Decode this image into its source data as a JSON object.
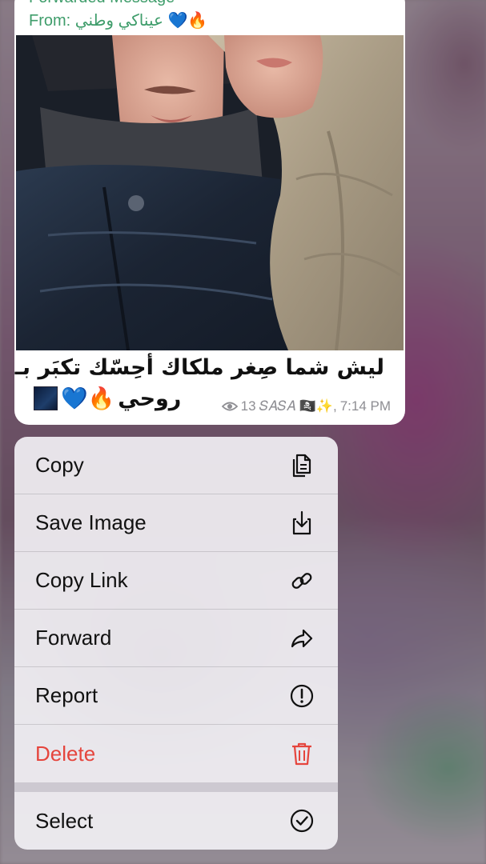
{
  "message": {
    "forward_title": "Forwarded Message",
    "forward_from_label": "From:",
    "forward_from_name": "عيناكي وطني",
    "forward_from_emoji": "💙🔥",
    "caption_line1": "ليش شما صِغر ملكاك أحِسّك تكبَر بـ",
    "caption_line2": "روحي",
    "caption_emoji": "💙🔥",
    "views": "13",
    "author": "𝑆𝐴𝑆𝐴 🏴‍☠️✨,",
    "time": "7:14 PM"
  },
  "menu": {
    "items": [
      {
        "label": "Copy",
        "icon": "copy-icon"
      },
      {
        "label": "Save Image",
        "icon": "save-image-icon"
      },
      {
        "label": "Copy Link",
        "icon": "link-icon"
      },
      {
        "label": "Forward",
        "icon": "forward-icon"
      },
      {
        "label": "Report",
        "icon": "report-icon"
      },
      {
        "label": "Delete",
        "icon": "trash-icon",
        "color": "#e5453d"
      },
      {
        "label": "Select",
        "icon": "select-check-icon"
      }
    ]
  },
  "colors": {
    "forward_green": "#3f9d6b",
    "danger_red": "#e5453d",
    "meta_gray": "#8e8e93"
  }
}
